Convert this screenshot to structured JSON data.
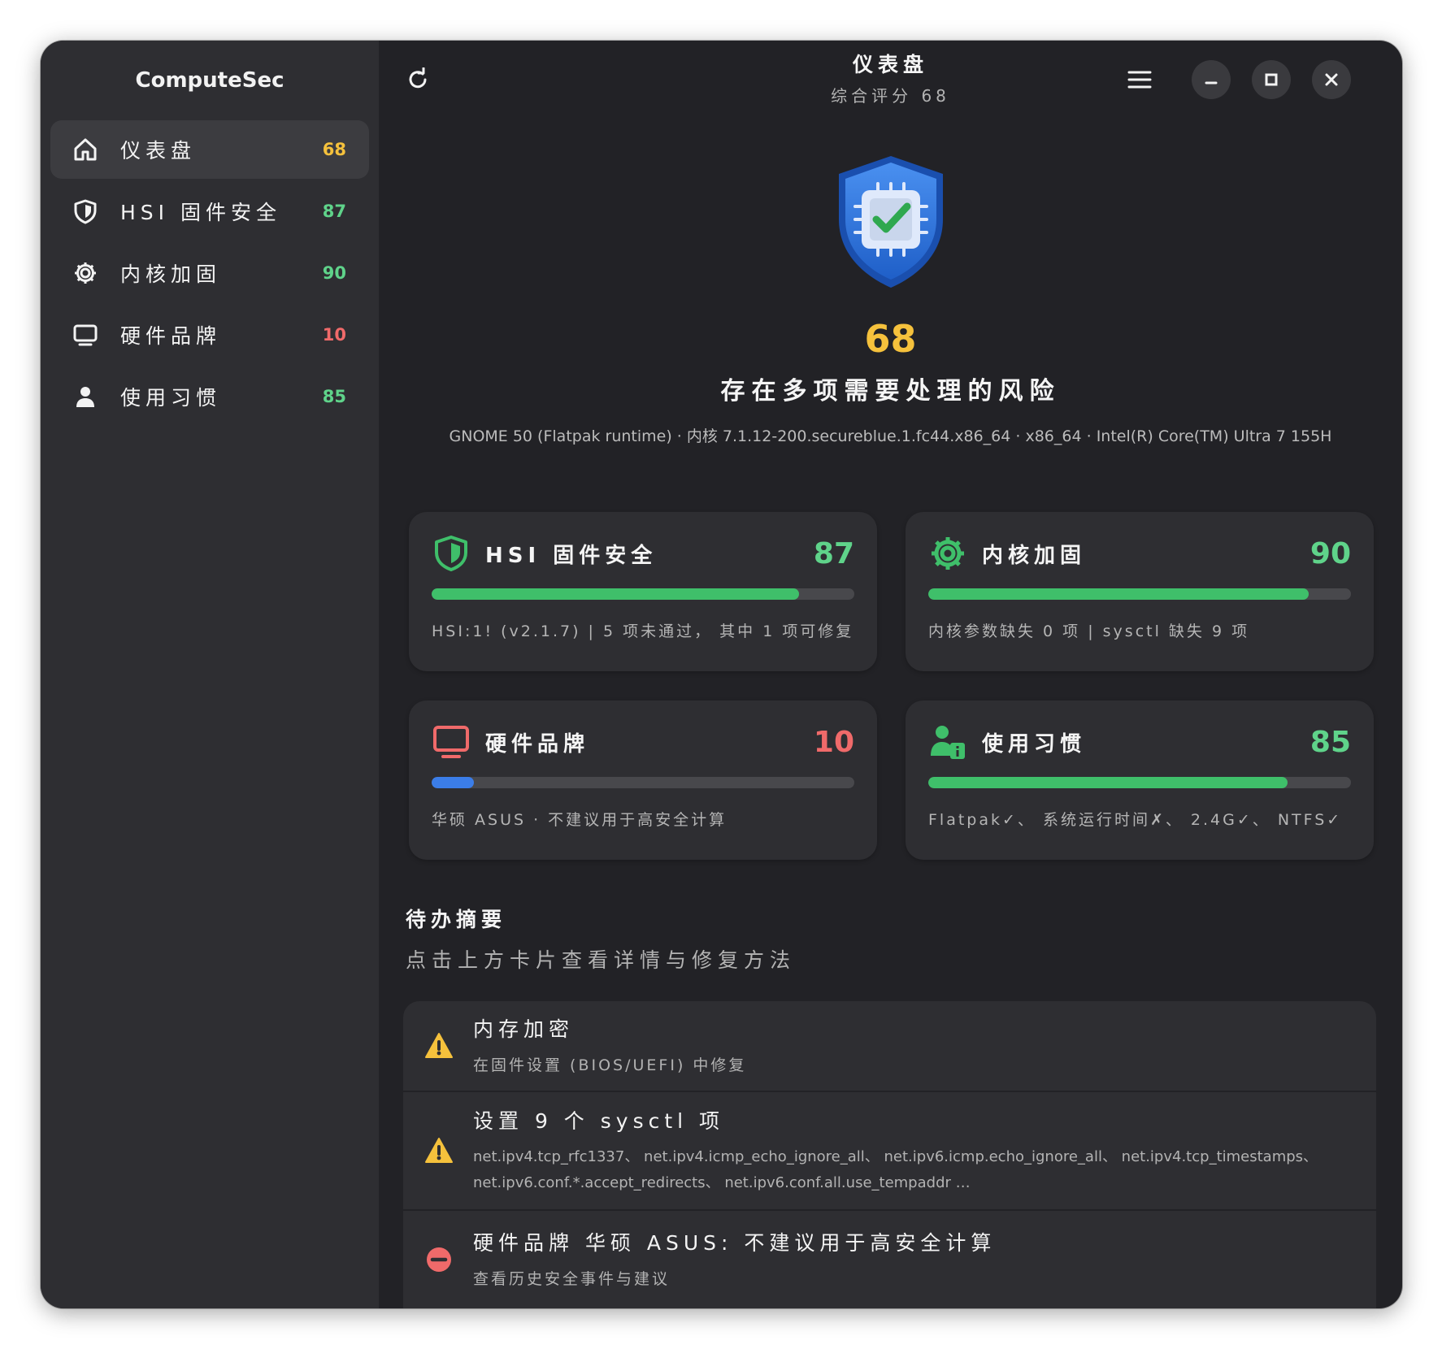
{
  "app": {
    "title": "ComputeSec"
  },
  "colors": {
    "green": "#3fbf6a",
    "yellow": "#f5c13c",
    "red": "#f06a6a",
    "blue": "#3b7de8",
    "score_green": "#5fd38a"
  },
  "sidebar": {
    "items": [
      {
        "label": "仪表盘",
        "score": "68",
        "icon": "home-icon",
        "active": true
      },
      {
        "label": "HSI 固件安全",
        "score": "87",
        "icon": "shield-icon",
        "active": false
      },
      {
        "label": "内核加固",
        "score": "90",
        "icon": "gear-icon",
        "active": false
      },
      {
        "label": "硬件品牌",
        "score": "10",
        "icon": "monitor-icon",
        "active": false
      },
      {
        "label": "使用习惯",
        "score": "85",
        "icon": "user-icon",
        "active": false
      }
    ]
  },
  "header": {
    "title": "仪表盘",
    "subtitle": "综合评分 68",
    "refresh_icon": "refresh-icon",
    "menu_icon": "hamburger-menu-icon",
    "minimize_icon": "minimize-icon",
    "maximize_icon": "maximize-icon",
    "close_icon": "close-icon"
  },
  "hero": {
    "badge_icon": "shield-chip-check-icon",
    "score": "68",
    "message": "存在多项需要处理的风险",
    "system_info": "GNOME 50 (Flatpak runtime) · 内核 7.1.12-200.secureblue.1.fc44.x86_64 · x86_64 · Intel(R) Core(TM) Ultra 7 155H"
  },
  "cards": [
    {
      "title": "HSI 固件安全",
      "score": "87",
      "progress": 0.87,
      "desc": "HSI:1! (v2.1.7) | 5 项未通过， 其中 1 项可修复",
      "icon": "shield-icon"
    },
    {
      "title": "内核加固",
      "score": "90",
      "progress": 0.9,
      "desc": "内核参数缺失 0 项 | sysctl 缺失 9 项",
      "icon": "gear-icon"
    },
    {
      "title": "硬件品牌",
      "score": "10",
      "progress": 0.1,
      "desc": "华硕 ASUS · 不建议用于高安全计算",
      "icon": "monitor-icon"
    },
    {
      "title": "使用习惯",
      "score": "85",
      "progress": 0.85,
      "desc": "Flatpak✓、 系统运行时间✗、 2.4G✓、 NTFS✓",
      "icon": "user-info-icon"
    }
  ],
  "todo": {
    "title": "待办摘要",
    "subtitle": "点击上方卡片查看详情与修复方法",
    "items": [
      {
        "icon": "warning-icon",
        "title": "内存加密",
        "desc": "在固件设置 (BIOS/UEFI) 中修复"
      },
      {
        "icon": "warning-icon",
        "title": "设置 9 个 sysctl 项",
        "desc": "net.ipv4.tcp_rfc1337、 net.ipv4.icmp_echo_ignore_all、 net.ipv6.icmp.echo_ignore_all、 net.ipv4.tcp_timestamps、 net.ipv6.conf.*.accept_redirects、 net.ipv6.conf.all.use_tempaddr …"
      },
      {
        "icon": "blocked-icon",
        "title": "硬件品牌 华硕 ASUS: 不建议用于高安全计算",
        "desc": "查看历史安全事件与建议"
      }
    ]
  }
}
